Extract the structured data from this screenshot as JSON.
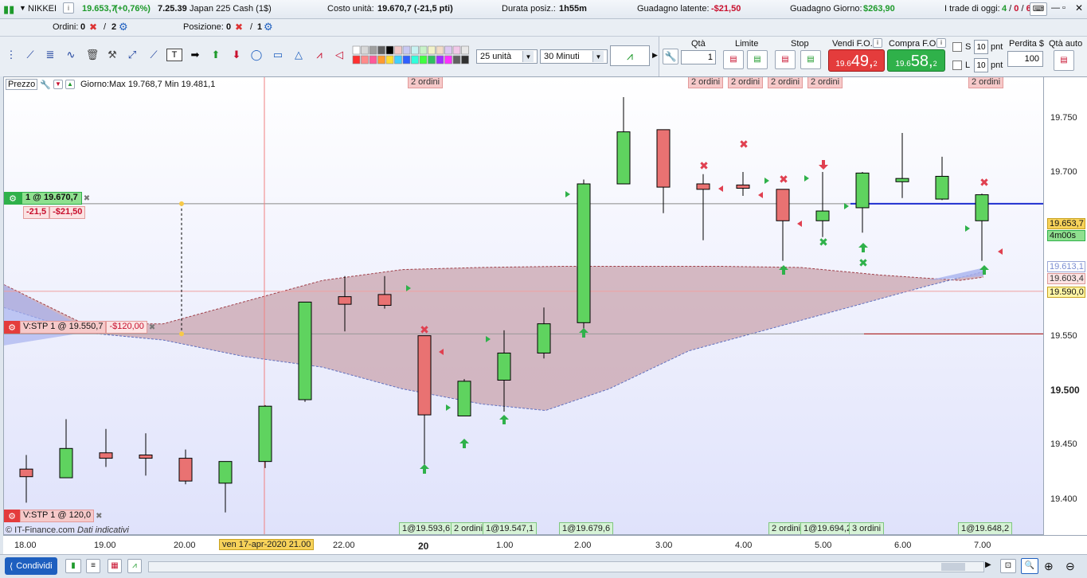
{
  "top": {
    "instrument": "NIKKEI",
    "price": "19.653,7",
    "change": "(+0,76%)",
    "time": "7.25.39",
    "name": "Japan 225 Cash (1$)",
    "costo_label": "Costo unità:",
    "costo_value": "19.670,7 (-21,5 pti)",
    "durata_label": "Durata posiz.:",
    "durata_value": "1h55m",
    "guadagno_lat_label": "Guadagno latente:",
    "guadagno_lat_value": "-$21,50",
    "guadagno_giorno_label": "Guadagno Giorno:",
    "guadagno_giorno_value": "$263,90",
    "trade_label": "I trade di oggi:",
    "trade_a": "4",
    "trade_b": "0",
    "trade_c": "6"
  },
  "row2": {
    "ordini_label": "Ordini:",
    "ordini_a": "0",
    "ordini_b": "2",
    "posizione_label": "Posizione:",
    "posizione_a": "0",
    "posizione_b": "1"
  },
  "toolbar": {
    "units": "25 unità",
    "timeframe": "30 Minuti"
  },
  "order_panel": {
    "qty_label": "Qtà",
    "qty_value": "1",
    "limite_label": "Limite",
    "stop_label": "Stop",
    "sell_label": "Vendi F.O.",
    "sell_small": "19.6",
    "sell_big": "49,",
    "sell_sup": "2",
    "buy_label": "Compra F.O.",
    "buy_small": "19.6",
    "buy_big": "58,",
    "buy_sup": "2",
    "s_label": "S",
    "s_value": "10",
    "l_label": "L",
    "l_value": "10",
    "pnt": "pnt",
    "perdita_label": "Perdita $",
    "perdita_value": "100",
    "qta_auto_label": "Qtà auto"
  },
  "chart": {
    "price_label": "Prezzo",
    "day_info": "Giorno:Max 19.768,7 Min 19.481,1",
    "copyright": "© IT-Finance.com",
    "disclaimer": "Dati indicativi",
    "position_tag": "1 @ 19.670,7",
    "position_pts": "-21,5",
    "position_usd": "-$21,50",
    "stop_tag": "V:STP  1 @ 19.550,7",
    "stop_usd": "-$120,00",
    "stop2_tag": "V:STP  1 @ 120,0",
    "orders_top": [
      "2 ordini",
      "2 ordini",
      "2 ordini",
      "2 ordini",
      "2 ordini",
      "2 ordini"
    ],
    "orders_bottom": [
      "1@19.593,6",
      "2 ordini",
      "1@19.547,1",
      "1@19.679,6",
      "2 ordini",
      "1@19.694,2",
      "3 ordini",
      "1@19.648,2"
    ]
  },
  "yaxis": {
    "labels": [
      "19.750",
      "19.700",
      "19.550",
      "19.500",
      "19.450",
      "19.400"
    ],
    "tag_price": "19.653,7",
    "tag_timer": "4m00s",
    "tag_a": "19.613,1",
    "tag_b": "19.603,4",
    "tag_c": "19.590,0"
  },
  "xaxis": {
    "labels": [
      "18.00",
      "19.00",
      "20.00",
      "22.00",
      "20",
      "1.00",
      "2.00",
      "3.00",
      "4.00",
      "5.00",
      "6.00",
      "7.00"
    ],
    "cursor": "ven 17-apr-2020 21.00"
  },
  "bottom": {
    "share_label": "Condividi"
  },
  "colors": {
    "up": "#5fd35f",
    "down": "#e97272",
    "cloud": "#c9a4ad",
    "accent": "#1e5fbf"
  }
}
